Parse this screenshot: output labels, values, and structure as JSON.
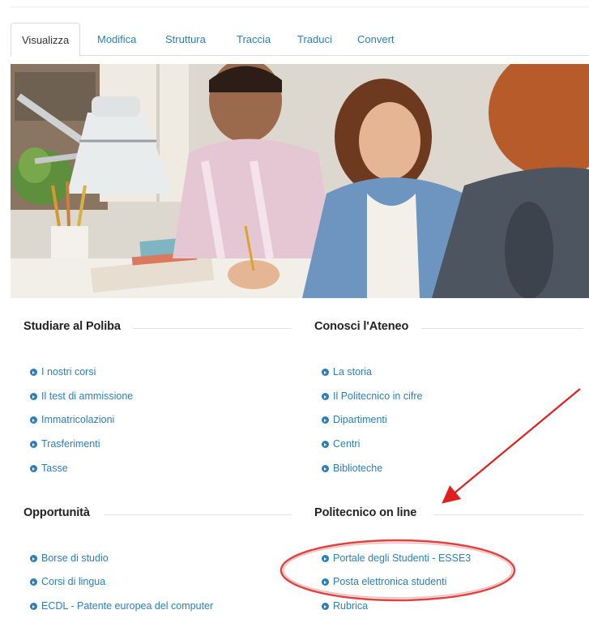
{
  "tabs": [
    {
      "label": "Visualizza",
      "active": true
    },
    {
      "label": "Modifica"
    },
    {
      "label": "Struttura"
    },
    {
      "label": "Traccia"
    },
    {
      "label": "Traduci"
    },
    {
      "label": "Convert"
    }
  ],
  "sections": {
    "studiare": {
      "title": "Studiare al Poliba",
      "links": [
        "I nostri corsi",
        "Il test di ammissione",
        "Immatricolazioni",
        "Trasferimenti",
        "Tasse"
      ]
    },
    "conosci": {
      "title": "Conosci l'Ateneo",
      "links": [
        "La storia",
        "Il Politecnico in cifre",
        "Dipartimenti",
        "Centri",
        "Biblioteche"
      ]
    },
    "opportunita": {
      "title": "Opportunità",
      "links": [
        "Borse di studio",
        "Corsi di lingua",
        "ECDL - Patente europea del computer"
      ]
    },
    "online": {
      "title": "Politecnico on line",
      "links": [
        "Portale degli Studenti - ESSE3",
        "Posta elettronica studenti",
        "Rubrica"
      ]
    }
  },
  "colors": {
    "link": "#2a7fb8",
    "annotation": "#e01f1f"
  },
  "annotation": {
    "arrow_icon": "red-arrow",
    "highlight_icon": "red-ellipse"
  }
}
